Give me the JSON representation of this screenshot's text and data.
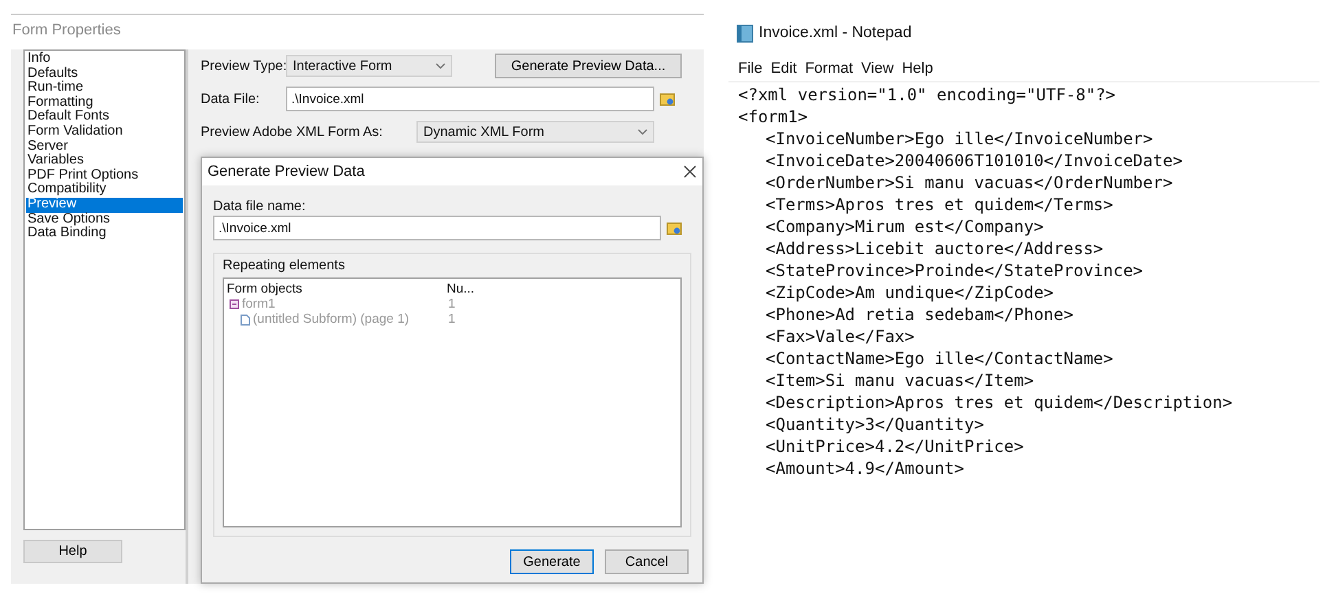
{
  "form_properties": {
    "title": "Form Properties",
    "categories": [
      {
        "label": "Info",
        "selected": false
      },
      {
        "label": "Defaults",
        "selected": false
      },
      {
        "label": "Run-time",
        "selected": false
      },
      {
        "label": "Formatting",
        "selected": false
      },
      {
        "label": "Default Fonts",
        "selected": false
      },
      {
        "label": "Form Validation",
        "selected": false
      },
      {
        "label": "Server",
        "selected": false
      },
      {
        "label": "Variables",
        "selected": false
      },
      {
        "label": "PDF Print Options",
        "selected": false
      },
      {
        "label": "Compatibility",
        "selected": false
      },
      {
        "label": "Preview",
        "selected": true
      },
      {
        "label": "Save Options",
        "selected": false
      },
      {
        "label": "Data Binding",
        "selected": false
      }
    ],
    "help_button": "Help",
    "preview_type": {
      "label": "Preview Type:",
      "value": "Interactive Form"
    },
    "generate_preview_button": "Generate Preview Data...",
    "data_file": {
      "label": "Data File:",
      "value": ".\\Invoice.xml"
    },
    "preview_as": {
      "label": "Preview Adobe XML Form As:",
      "value": "Dynamic XML Form"
    }
  },
  "dialog": {
    "title": "Generate Preview Data",
    "data_file_name": {
      "label": "Data file name:",
      "value": ".\\Invoice.xml"
    },
    "group_title": "Repeating elements",
    "columns": [
      "Form objects",
      "Nu..."
    ],
    "tree": [
      {
        "name": "form1",
        "count": "1",
        "expanded": true,
        "children": [
          {
            "name": "(untitled Subform) (page 1)",
            "count": "1"
          }
        ]
      }
    ],
    "buttons": [
      {
        "label": "Generate",
        "default": true
      },
      {
        "label": "Cancel",
        "default": false
      }
    ]
  },
  "notepad": {
    "title": "Invoice.xml - Notepad",
    "menu": [
      "File",
      "Edit",
      "Format",
      "View",
      "Help"
    ],
    "lines": [
      {
        "text": "<?xml version=\"1.0\" encoding=\"UTF-8\"?>"
      },
      {
        "text": "<form1>",
        "children": [
          {
            "text": "<InvoiceNumber>Ego ille</InvoiceNumber>"
          },
          {
            "text": "<InvoiceDate>20040606T101010</InvoiceDate>"
          },
          {
            "text": "<OrderNumber>Si manu vacuas</OrderNumber>"
          },
          {
            "text": "<Terms>Apros tres et quidem</Terms>"
          },
          {
            "text": "<Company>Mirum est</Company>"
          },
          {
            "text": "<Address>Licebit auctore</Address>"
          },
          {
            "text": "<StateProvince>Proinde</StateProvince>"
          },
          {
            "text": "<ZipCode>Am undique</ZipCode>"
          },
          {
            "text": "<Phone>Ad retia sedebam</Phone>"
          },
          {
            "text": "<Fax>Vale</Fax>"
          },
          {
            "text": "<ContactName>Ego ille</ContactName>"
          },
          {
            "text": "<Item>Si manu vacuas</Item>"
          },
          {
            "text": "<Description>Apros tres et quidem</Description>"
          },
          {
            "text": "<Quantity>3</Quantity>"
          },
          {
            "text": "<UnitPrice>4.2</UnitPrice>"
          },
          {
            "text": "<Amount>4.9</Amount>"
          }
        ]
      }
    ]
  }
}
